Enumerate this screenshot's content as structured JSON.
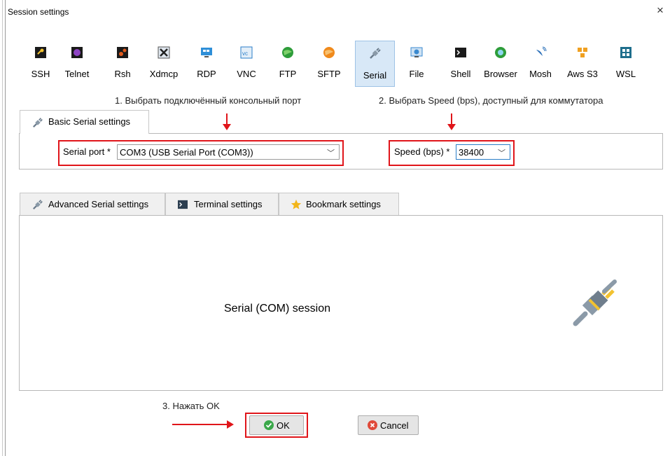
{
  "window": {
    "title": "Session settings",
    "close": "×"
  },
  "protocols": [
    {
      "label": "SSH",
      "icon": "ssh-key-icon",
      "color": "#1a1a1a"
    },
    {
      "label": "Telnet",
      "icon": "telnet-icon",
      "color": "#7b3fb0"
    },
    {
      "label": "Rsh",
      "icon": "rsh-icon",
      "color": "#d2561c"
    },
    {
      "label": "Xdmcp",
      "icon": "xdmcp-icon",
      "color": "#333333"
    },
    {
      "label": "RDP",
      "icon": "rdp-icon",
      "color": "#2f8fd8"
    },
    {
      "label": "VNC",
      "icon": "vnc-icon",
      "color": "#2a7ec8"
    },
    {
      "label": "FTP",
      "icon": "ftp-icon",
      "color": "#2e9d3a"
    },
    {
      "label": "SFTP",
      "icon": "sftp-icon",
      "color": "#f08a1c"
    },
    {
      "label": "Serial",
      "icon": "serial-plug-icon",
      "color": "#6b7c8c"
    },
    {
      "label": "File",
      "icon": "file-icon",
      "color": "#3a8ad0"
    },
    {
      "label": "Shell",
      "icon": "shell-icon",
      "color": "#1a1a1a"
    },
    {
      "label": "Browser",
      "icon": "browser-globe-icon",
      "color": "#2e9d3a"
    },
    {
      "label": "Mosh",
      "icon": "mosh-satellite-icon",
      "color": "#2a6fb8"
    },
    {
      "label": "Aws S3",
      "icon": "aws-s3-icon",
      "color": "#f0a020"
    },
    {
      "label": "WSL",
      "icon": "wsl-windows-icon",
      "color": "#1e6e8c"
    }
  ],
  "notes": {
    "step1": "1. Выбрать подключённый консольный порт",
    "step2": "2. Выбрать Speed (bps), доступный для коммутатора",
    "step3": "3. Нажать OK"
  },
  "basic_tab": {
    "label": "Basic Serial settings"
  },
  "serial_port": {
    "label": "Serial port *",
    "value": "COM3  (USB Serial Port (COM3))"
  },
  "speed": {
    "label": "Speed (bps) *",
    "value": "38400"
  },
  "lower_tabs": [
    {
      "label": "Advanced Serial settings"
    },
    {
      "label": "Terminal settings"
    },
    {
      "label": "Bookmark settings"
    }
  ],
  "session_caption": "Serial (COM) session",
  "buttons": {
    "ok": "OK",
    "cancel": "Cancel"
  },
  "colors": {
    "accent_red": "#e0151a",
    "selected_bg": "#d8e8f7"
  }
}
